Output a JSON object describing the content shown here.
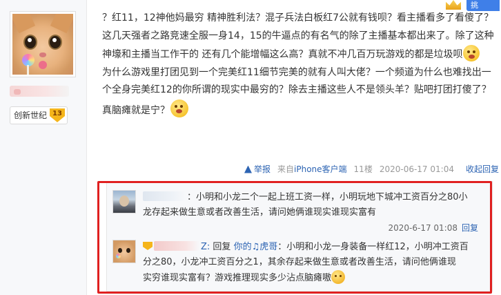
{
  "user": {
    "forum_name": "创新世纪",
    "forum_level": "13"
  },
  "top_badges": {
    "report_label": "挑 "
  },
  "post": {
    "line1": "？红11，12神他妈最穷 精神胜利法？混子兵法白板红7公就有钱呗？看主播看多了看傻了？",
    "line2": "这几天强者之路竞速全服一身14，15的牛逼点的有名气的除了主播基本都出来了。除了这种",
    "line3": "神壕和主播当工作干的 还有几个能增幅这么高？真就不冲几百万玩游戏的都是垃圾呗",
    "line4": "为什么游戏里打团见到一个完美红11细节完美的就有人叫大佬？一个频道为什么也难找出一",
    "line5": "个全身完美红12的你所谓的现实中最穷的？除去主播这些人不是领头羊？贴吧打团打傻了？",
    "line6": "真脑瘫就是宁？"
  },
  "meta": {
    "report": "举报",
    "device_prefix": "来自",
    "device_link": "iPhone客户端",
    "floor": "11楼",
    "timestamp": "2020-06-17 01:04",
    "collapse": "收起回复"
  },
  "replies": [
    {
      "name_tail": "",
      "text_a": "：小明和小龙二个一起上班工资一样，小明玩地下城冲工资百分之80小",
      "text_b": "龙存起来做生意或者改善生活，请问她俩谁现实谁现实富有",
      "timestamp": "2020-6-17 01:08",
      "reply_link": "回复"
    },
    {
      "name_tail": "Z:",
      "reply_word": " 回复 ",
      "reply_to": "你的♫虎哥",
      "text_a": "：小明和小龙一身装备一样红12，小明冲工资百",
      "text_b": "分之80，小龙冲工资百分之1，其余存起来做生意或者改善生活，请问他俩谁现",
      "text_c": "实穷谁现实富有？游戏推理现实多少沾点脑瘫嗷"
    }
  ]
}
